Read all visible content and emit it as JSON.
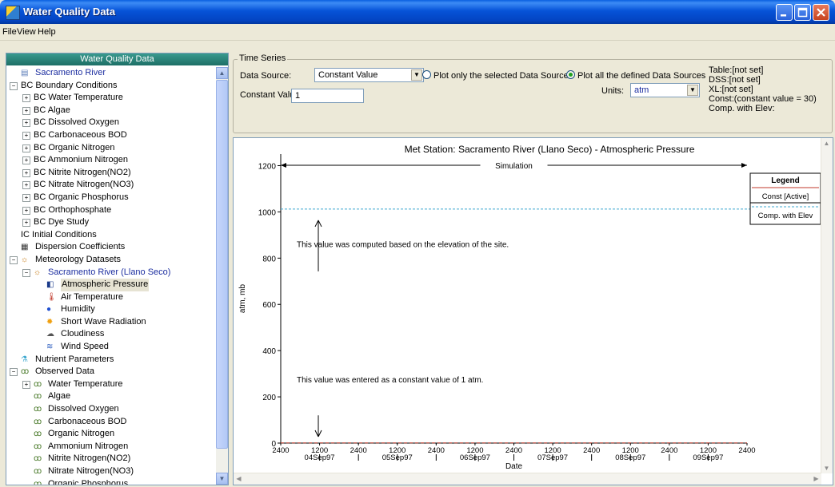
{
  "window": {
    "title": "Water Quality Data"
  },
  "menu": [
    "File",
    "View",
    "Help"
  ],
  "tree": {
    "header": "Water Quality Data",
    "items": [
      {
        "label": "Sacramento River",
        "indent": 0,
        "exp": "",
        "icon": "document-icon",
        "blue": true
      },
      {
        "label": "BC Boundary Conditions",
        "indent": 0,
        "exp": "-",
        "icon": ""
      },
      {
        "label": "BC Water Temperature",
        "indent": 1,
        "exp": "+",
        "icon": ""
      },
      {
        "label": "BC Algae",
        "indent": 1,
        "exp": "+",
        "icon": ""
      },
      {
        "label": "BC Dissolved Oxygen",
        "indent": 1,
        "exp": "+",
        "icon": ""
      },
      {
        "label": "BC Carbonaceous BOD",
        "indent": 1,
        "exp": "+",
        "icon": ""
      },
      {
        "label": "BC Organic Nitrogen",
        "indent": 1,
        "exp": "+",
        "icon": ""
      },
      {
        "label": "BC Ammonium Nitrogen",
        "indent": 1,
        "exp": "+",
        "icon": ""
      },
      {
        "label": "BC Nitrite Nitrogen(NO2)",
        "indent": 1,
        "exp": "+",
        "icon": ""
      },
      {
        "label": "BC Nitrate Nitrogen(NO3)",
        "indent": 1,
        "exp": "+",
        "icon": ""
      },
      {
        "label": "BC Organic Phosphorus",
        "indent": 1,
        "exp": "+",
        "icon": ""
      },
      {
        "label": "BC Orthophosphate",
        "indent": 1,
        "exp": "+",
        "icon": ""
      },
      {
        "label": "BC Dye Study",
        "indent": 1,
        "exp": "+",
        "icon": ""
      },
      {
        "label": "IC  Initial Conditions",
        "indent": 0,
        "exp": "",
        "icon": ""
      },
      {
        "label": "Dispersion Coefficients",
        "indent": 0,
        "exp": "",
        "icon": "grid-icon"
      },
      {
        "label": "Meteorology Datasets",
        "indent": 0,
        "exp": "-",
        "icon": "weather-icon"
      },
      {
        "label": "Sacramento River (Llano Seco)",
        "indent": 1,
        "exp": "-",
        "icon": "weather-icon",
        "blue": true
      },
      {
        "label": "Atmospheric Pressure",
        "indent": 2,
        "exp": "",
        "icon": "barometer-icon",
        "selected": true
      },
      {
        "label": "Air Temperature",
        "indent": 2,
        "exp": "",
        "icon": "thermometer-icon"
      },
      {
        "label": "Humidity",
        "indent": 2,
        "exp": "",
        "icon": "droplet-icon"
      },
      {
        "label": "Short Wave Radiation",
        "indent": 2,
        "exp": "",
        "icon": "sun-icon"
      },
      {
        "label": "Cloudiness",
        "indent": 2,
        "exp": "",
        "icon": "cloud-icon"
      },
      {
        "label": "Wind Speed",
        "indent": 2,
        "exp": "",
        "icon": "wind-icon"
      },
      {
        "label": "Nutrient Parameters",
        "indent": 0,
        "exp": "",
        "icon": "flask-icon"
      },
      {
        "label": "Observed Data",
        "indent": 0,
        "exp": "-",
        "icon": "binoculars-icon"
      },
      {
        "label": "Water Temperature",
        "indent": 1,
        "exp": "+",
        "icon": "binoculars-icon"
      },
      {
        "label": "Algae",
        "indent": 1,
        "exp": "",
        "icon": "binoculars-icon"
      },
      {
        "label": "Dissolved Oxygen",
        "indent": 1,
        "exp": "",
        "icon": "binoculars-icon"
      },
      {
        "label": "Carbonaceous BOD",
        "indent": 1,
        "exp": "",
        "icon": "binoculars-icon"
      },
      {
        "label": "Organic Nitrogen",
        "indent": 1,
        "exp": "",
        "icon": "binoculars-icon"
      },
      {
        "label": "Ammonium Nitrogen",
        "indent": 1,
        "exp": "",
        "icon": "binoculars-icon"
      },
      {
        "label": "Nitrite Nitrogen(NO2)",
        "indent": 1,
        "exp": "",
        "icon": "binoculars-icon"
      },
      {
        "label": "Nitrate Nitrogen(NO3)",
        "indent": 1,
        "exp": "",
        "icon": "binoculars-icon"
      },
      {
        "label": "Organic Phosphorus",
        "indent": 1,
        "exp": "",
        "icon": "binoculars-icon"
      }
    ]
  },
  "timeseries": {
    "group_label": "Time Series",
    "data_source_label": "Data Source:",
    "data_source_value": "Constant Value",
    "radio_selected_label": "Plot only the selected Data Source",
    "radio_all_label": "Plot all the defined Data Sources",
    "constant_value_label": "Constant Value:",
    "constant_value": "1",
    "units_label": "Units:",
    "units_value": "atm",
    "status": [
      "Table:[not set]",
      "DSS:[not set]",
      "XL:[not set]",
      "Const:(constant value = 30)",
      "Comp. with Elev:"
    ]
  },
  "colors": {
    "const_series": "#c0392b",
    "elev_series": "#3fa9d0",
    "tree_header": "#1d6f66",
    "title_bar": "#0653d8"
  },
  "chart_data": {
    "type": "line",
    "title": "Met Station: Sacramento River (Llano Seco) - Atmospheric Pressure",
    "xlabel": "Date",
    "ylabel": "atm, mb",
    "ylim": [
      0,
      1250
    ],
    "yticks": [
      0,
      200,
      400,
      600,
      800,
      1000,
      1200
    ],
    "xlim": [
      "03Sep97 2400",
      "09Sep97 2400"
    ],
    "x_tick_labels": [
      {
        "top": "2400",
        "bottom": ""
      },
      {
        "top": "1200",
        "bottom": "04Sep97"
      },
      {
        "top": "2400",
        "bottom": ""
      },
      {
        "top": "1200",
        "bottom": "05Sep97"
      },
      {
        "top": "2400",
        "bottom": ""
      },
      {
        "top": "1200",
        "bottom": "06Sep97"
      },
      {
        "top": "2400",
        "bottom": ""
      },
      {
        "top": "1200",
        "bottom": "07Sep97"
      },
      {
        "top": "2400",
        "bottom": ""
      },
      {
        "top": "1200",
        "bottom": "08Sep97"
      },
      {
        "top": "2400",
        "bottom": ""
      },
      {
        "top": "1200",
        "bottom": "09Sep97"
      },
      {
        "top": "2400",
        "bottom": ""
      }
    ],
    "span_label": "Simulation",
    "series": [
      {
        "name": "Const [Active]",
        "value": 1,
        "style": "solid"
      },
      {
        "name": "Comp. with Elev",
        "value": 1012,
        "style": "dashed"
      }
    ],
    "legend": {
      "title": "Legend",
      "placement": "top-right"
    },
    "annotations": [
      "This value was computed based on the elevation of the site.",
      "This value was entered as a constant value of 1 atm."
    ]
  }
}
